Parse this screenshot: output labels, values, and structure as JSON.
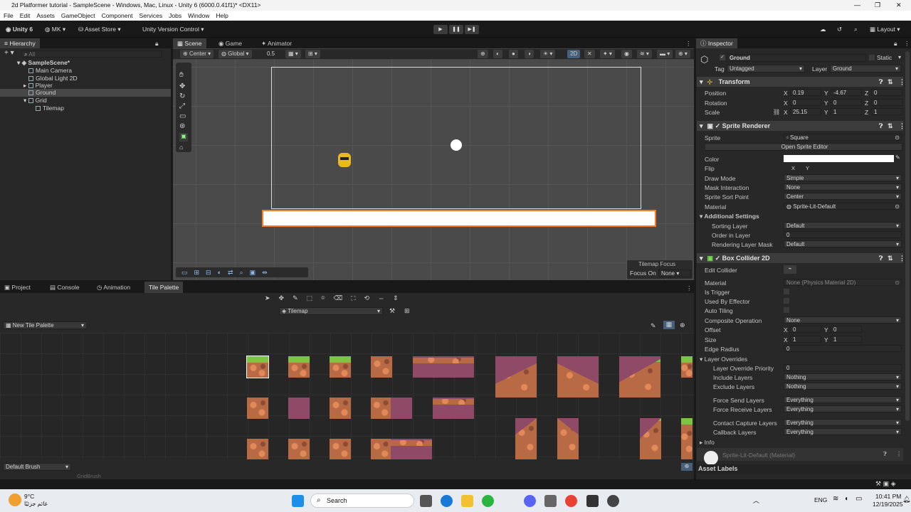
{
  "window": {
    "title": "2d Platformer tutorial - SampleScene - Windows, Mac, Linux - Unity 6 (6000.0.41f1)* <DX11>"
  },
  "menu": [
    "File",
    "Edit",
    "Assets",
    "GameObject",
    "Component",
    "Services",
    "Jobs",
    "Window",
    "Help"
  ],
  "toolbar": {
    "unity_label": "Unity 6",
    "account": "MK",
    "asset_store": "Asset Store",
    "version_control": "Unity Version Control",
    "layout": "Layout"
  },
  "hierarchy": {
    "tab": "Hierarchy",
    "search_placeholder": "All",
    "scene": "SampleScene*",
    "items": [
      "Main Camera",
      "Global Light 2D",
      "Player",
      "Ground",
      "Grid",
      "Tilemap"
    ]
  },
  "scene_tabs": [
    "Scene",
    "Game",
    "Animator"
  ],
  "scene_toolbar": {
    "pivot": "Center",
    "space": "Global",
    "snap": "0.5",
    "mode_2d": "2D"
  },
  "scene_overlay": {
    "title": "Tilemap Focus",
    "focus_label": "Focus On",
    "focus_value": "None"
  },
  "bottom_tabs": [
    "Project",
    "Console",
    "Animation",
    "Tile Palette"
  ],
  "tile_palette": {
    "target": "Tilemap",
    "palette": "New Tile Palette",
    "brush": "Default Brush",
    "brush_sub": "GridBrush"
  },
  "inspector": {
    "tab": "Inspector",
    "name": "Ground",
    "static": "Static",
    "tag_label": "Tag",
    "tag": "Untagged",
    "layer_label": "Layer",
    "layer": "Ground",
    "transform": {
      "title": "Transform",
      "position_label": "Position",
      "rotation_label": "Rotation",
      "scale_label": "Scale",
      "position": [
        "0.19",
        "-4.67",
        "0"
      ],
      "rotation": [
        "0",
        "0",
        "0"
      ],
      "scale": [
        "25.15",
        "1",
        "1"
      ]
    },
    "sprite_renderer": {
      "title": "Sprite Renderer",
      "sprite_label": "Sprite",
      "sprite": "Square",
      "open_editor": "Open Sprite Editor",
      "color_label": "Color",
      "flip_label": "Flip",
      "draw_mode_label": "Draw Mode",
      "draw_mode": "Simple",
      "mask_label": "Mask Interaction",
      "mask": "None",
      "sort_point_label": "Sprite Sort Point",
      "sort_point": "Center",
      "material_label": "Material",
      "material": "Sprite-Lit-Default",
      "additional": "Additional Settings",
      "sorting_layer_label": "Sorting Layer",
      "sorting_layer": "Default",
      "order_label": "Order in Layer",
      "order": "0",
      "rendering_mask_label": "Rendering Layer Mask",
      "rendering_mask": "Default"
    },
    "box_collider": {
      "title": "Box Collider 2D",
      "edit_label": "Edit Collider",
      "material_label": "Material",
      "material": "None (Physics Material 2D)",
      "trigger_label": "Is Trigger",
      "effector_label": "Used By Effector",
      "tiling_label": "Auto Tiling",
      "composite_label": "Composite Operation",
      "composite": "None",
      "offset_label": "Offset",
      "offset": [
        "0",
        "0"
      ],
      "size_label": "Size",
      "size": [
        "1",
        "1"
      ],
      "edge_label": "Edge Radius",
      "edge": "0",
      "overrides": "Layer Overrides",
      "priority_label": "Layer Override Priority",
      "priority": "0",
      "include_label": "Include Layers",
      "include": "Nothing",
      "exclude_label": "Exclude Layers",
      "exclude": "Nothing",
      "force_send_label": "Force Send Layers",
      "force_send": "Everything",
      "force_receive_label": "Force Receive Layers",
      "force_receive": "Everything",
      "contact_label": "Contact Capture Layers",
      "contact": "Everything",
      "callback_label": "Callback Layers",
      "callback": "Everything",
      "info": "Info"
    },
    "material_footer": "Sprite-Lit-Default (Material)",
    "asset_labels": "Asset Labels"
  },
  "taskbar": {
    "temp": "9°C",
    "weather": "غائم جزئيًا",
    "search": "Search",
    "lang": "ENG",
    "time": "10:41 PM",
    "date": "12/19/2025"
  }
}
